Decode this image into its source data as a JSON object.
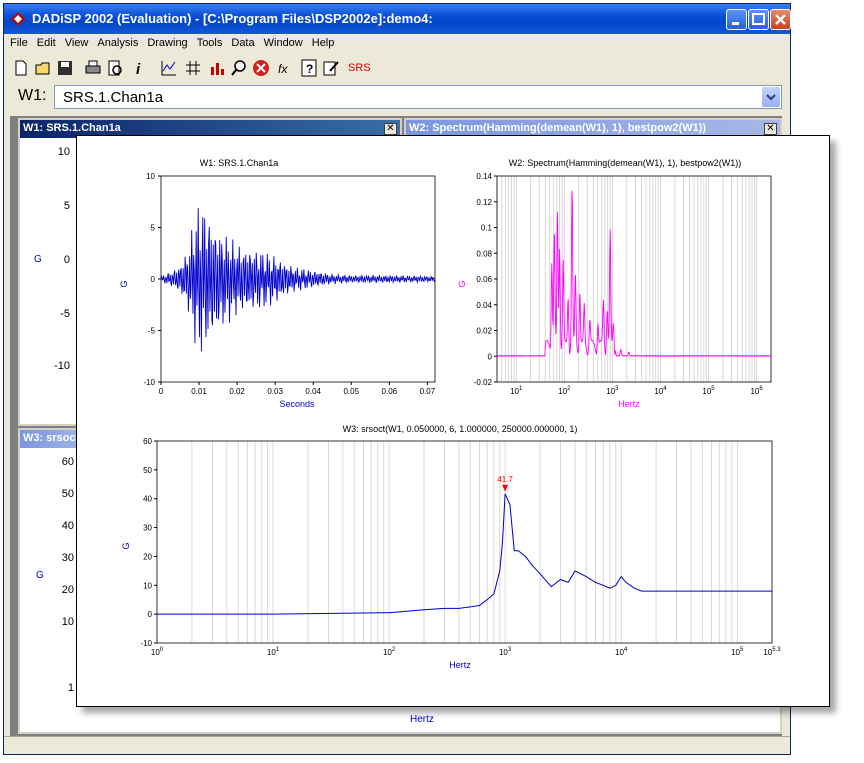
{
  "window": {
    "title": "DADiSP 2002 (Evaluation) - [C:\\Program Files\\DSP2002e]:demo4:"
  },
  "menu": [
    "File",
    "Edit",
    "View",
    "Analysis",
    "Drawing",
    "Tools",
    "Data",
    "Window",
    "Help"
  ],
  "toolbar": {
    "srs_label": "SRS"
  },
  "formula_bar": {
    "label": "W1:",
    "value": "SRS.1.Chan1a"
  },
  "windows": {
    "w1_caption": "W1: SRS.1.Chan1a",
    "w2_caption": "W2: Spectrum(Hamming(demean(W1), 1), bestpow2(W1))",
    "w3_caption": "W3: srsoct",
    "close_glyph": "✕",
    "w1_bg_ticks": [
      "10",
      "5",
      "0",
      "-5",
      "-10"
    ],
    "w1_bg_ylabel": "G",
    "w3_bg_ticks": [
      "60",
      "50",
      "40",
      "30",
      "20",
      "10",
      "1"
    ],
    "w3_bg_ylabel": "G",
    "w3_bg_xlabel": "Hertz"
  },
  "chart_data": [
    {
      "type": "line",
      "title": "W1:  SRS.1.Chan1a",
      "xlabel": "Seconds",
      "ylabel": "G",
      "xlim": [
        0,
        0.072
      ],
      "ylim": [
        -10,
        10
      ],
      "xticks": [
        "0",
        "0.01",
        "0.02",
        "0.03",
        "0.04",
        "0.05",
        "0.06",
        "0.07"
      ],
      "yticks": [
        "10",
        "5",
        "0",
        "-5",
        "-10"
      ],
      "color": "#0000cc",
      "envelope": {
        "t": [
          0,
          0.003,
          0.005,
          0.007,
          0.009,
          0.0105,
          0.012,
          0.015,
          0.02,
          0.025,
          0.03,
          0.035,
          0.04,
          0.045,
          0.05,
          0.06,
          0.072
        ],
        "pos": [
          0.3,
          0.8,
          1.5,
          3,
          6.5,
          8,
          7,
          5,
          3.5,
          3,
          2.3,
          1.2,
          0.9,
          0.5,
          0.4,
          0.4,
          0.3
        ],
        "neg": [
          -0.3,
          -0.8,
          -1.5,
          -3,
          -6.5,
          -8,
          -7,
          -5.5,
          -3.5,
          -3.3,
          -2.5,
          -1.3,
          -0.9,
          -0.5,
          -0.4,
          -0.4,
          -0.3
        ]
      }
    },
    {
      "type": "line",
      "title": "W2:  Spectrum(Hamming(demean(W1), 1), bestpow2(W1))",
      "xlabel": "Hertz",
      "ylabel": "G",
      "log_x": true,
      "ylim": [
        -0.02,
        0.14
      ],
      "yticks": [
        "0.14",
        "0.12",
        "0.1",
        "0.08",
        "0.06",
        "0.04",
        "0.02",
        "0",
        "-0.02"
      ],
      "xticks": [
        "10^1",
        "10^2",
        "10^3",
        "10^4",
        "10^5",
        "10^6"
      ],
      "color": "#ff00ff",
      "peaks": [
        {
          "f": 55,
          "a": 0.07
        },
        {
          "f": 62,
          "a": 0.09
        },
        {
          "f": 72,
          "a": 0.105
        },
        {
          "f": 80,
          "a": 0.08
        },
        {
          "f": 95,
          "a": 0.065
        },
        {
          "f": 120,
          "a": 0.04
        },
        {
          "f": 145,
          "a": 0.124
        },
        {
          "f": 170,
          "a": 0.055
        },
        {
          "f": 210,
          "a": 0.045
        },
        {
          "f": 260,
          "a": 0.03
        },
        {
          "f": 340,
          "a": 0.02
        },
        {
          "f": 500,
          "a": 0.02
        },
        {
          "f": 650,
          "a": 0.035
        },
        {
          "f": 780,
          "a": 0.03
        },
        {
          "f": 900,
          "a": 0.087
        },
        {
          "f": 1050,
          "a": 0.02
        },
        {
          "f": 1500,
          "a": 0.005
        },
        {
          "f": 2200,
          "a": 0.003
        }
      ]
    },
    {
      "type": "line",
      "title": "W3:  srsoct(W1, 0.050000, 6, 1.000000, 250000.000000, 1)",
      "xlabel": "Hertz",
      "ylabel": "G",
      "log_x": true,
      "xlim": [
        1,
        200000
      ],
      "ylim": [
        -10,
        60
      ],
      "yticks": [
        "60",
        "50",
        "40",
        "30",
        "20",
        "10",
        "0",
        "-10"
      ],
      "xticks": [
        "10^0",
        "10^1",
        "10^2",
        "10^3",
        "10^4",
        "10^5",
        "10^5.3"
      ],
      "color": "#0000cc",
      "x": [
        1,
        10,
        100,
        200,
        300,
        400,
        500,
        600,
        700,
        800,
        900,
        950,
        1000,
        1100,
        1200,
        1300,
        1500,
        1700,
        2000,
        2500,
        3000,
        3500,
        4000,
        5000,
        6000,
        7000,
        8000,
        9000,
        10000,
        11000,
        13000,
        15000,
        20000,
        50000,
        200000
      ],
      "y": [
        0,
        0,
        0.5,
        1.5,
        2,
        2,
        2.5,
        3,
        5,
        7,
        15,
        25,
        41.7,
        38,
        22,
        22,
        20,
        17,
        14,
        9.5,
        12,
        11,
        15,
        13,
        11,
        10,
        9,
        10,
        13,
        11,
        9,
        8,
        8,
        8,
        8
      ],
      "annotation": {
        "label": "41.7",
        "x": 1000,
        "y": 41.7,
        "color": "#ff0000"
      }
    }
  ]
}
